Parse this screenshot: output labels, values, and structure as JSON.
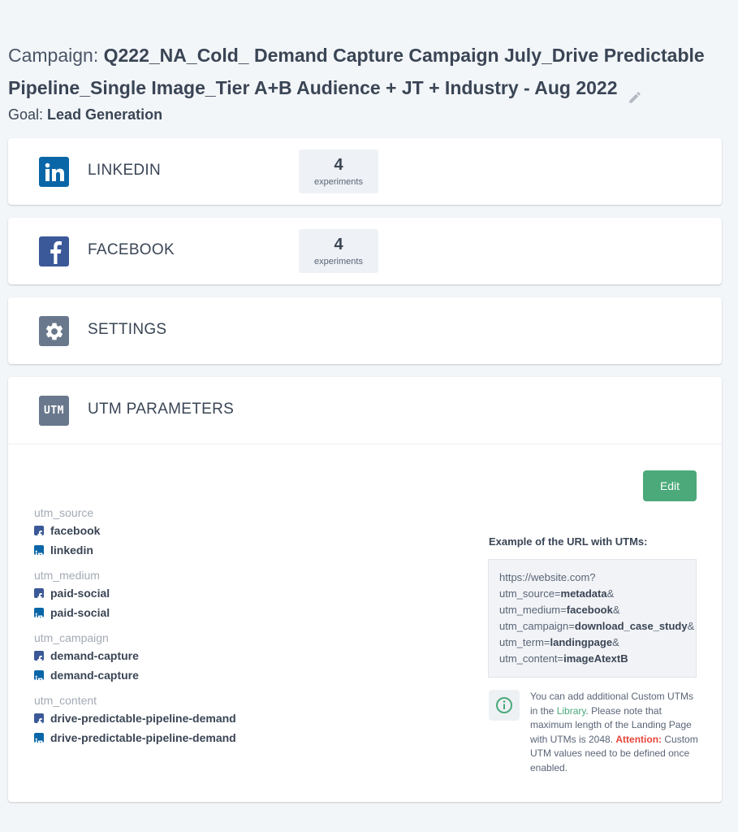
{
  "header": {
    "campaign_label": "Campaign:",
    "campaign_name": "Q222_NA_Cold_ Demand Capture Campaign July_Drive Predictable Pipeline_Single Image_Tier A+B Audience + JT + Industry - Aug 2022",
    "goal_label": "Goal:",
    "goal_value": "Lead Generation"
  },
  "channels": [
    {
      "title": "LINKEDIN",
      "icon": "linkedin-icon",
      "count": "4",
      "count_label": "experiments",
      "color": "#0a66a7"
    },
    {
      "title": "FACEBOOK",
      "icon": "facebook-icon",
      "count": "4",
      "count_label": "experiments",
      "color": "#3b5998"
    }
  ],
  "settings": {
    "title": "SETTINGS",
    "icon": "gear-icon",
    "color": "#69788c"
  },
  "utm": {
    "title": "UTM PARAMETERS",
    "icon_text": "UTM",
    "edit_label": "Edit",
    "groups": [
      {
        "key": "utm_source",
        "values": [
          {
            "network": "facebook",
            "value": "facebook"
          },
          {
            "network": "linkedin",
            "value": "linkedin"
          }
        ]
      },
      {
        "key": "utm_medium",
        "values": [
          {
            "network": "facebook",
            "value": "paid-social"
          },
          {
            "network": "linkedin",
            "value": "paid-social"
          }
        ]
      },
      {
        "key": "utm_campaign",
        "values": [
          {
            "network": "facebook",
            "value": "demand-capture"
          },
          {
            "network": "linkedin",
            "value": "demand-capture"
          }
        ]
      },
      {
        "key": "utm_content",
        "values": [
          {
            "network": "facebook",
            "value": "drive-predictable-pipeline-demand"
          },
          {
            "network": "linkedin",
            "value": "drive-predictable-pipeline-demand"
          }
        ]
      }
    ],
    "example_label": "Example of the URL with UTMs:",
    "example": {
      "base": "https://website.com?",
      "params": [
        {
          "k": "utm_source=",
          "v": "metadata",
          "sep": "&"
        },
        {
          "k": "utm_medium=",
          "v": "facebook",
          "sep": "&"
        },
        {
          "k": "utm_campaign=",
          "v": "download_case_study",
          "sep": "&"
        },
        {
          "k": "utm_term=",
          "v": "landingpage",
          "sep": "&"
        },
        {
          "k": "utm_content=",
          "v": "imageAtextB",
          "sep": ""
        }
      ]
    },
    "info": {
      "text1": "You can add additional Custom UTMs in the ",
      "library": "Library",
      "text2": ". Please note that maximum length of the Landing Page with UTMs is 2048. ",
      "attention": "Attention:",
      "text3": " Custom UTM values need to be defined once enabled."
    }
  },
  "colors": {
    "accent": "#4ba97a",
    "attention": "#e6453b",
    "linkedin": "#0a66a7",
    "facebook": "#3b5998"
  }
}
